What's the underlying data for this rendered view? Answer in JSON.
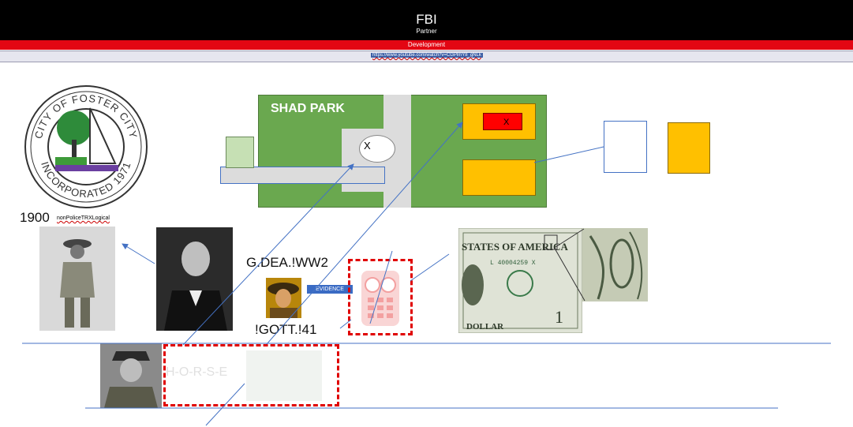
{
  "header": {
    "title": "FBI",
    "subtitle": "Partner",
    "bar_label": "Development",
    "url_text": "https://www.youtube.com/watch?v=CGPlmY8_gNLk"
  },
  "seal": {
    "top_text": "CITY OF FOSTER CITY",
    "bottom_text": "INCORPORATED 1971"
  },
  "park": {
    "title": "SHAD PARK",
    "marker_1": "X",
    "marker_2": "X"
  },
  "labels": {
    "year": "1900",
    "note": "nonPoliceTRXLogical",
    "gdea": "G.DEA.!WW2",
    "gott": "!GOTT.!41",
    "evidence": "EVIDENCE",
    "horse": "H-O-R-S-E"
  },
  "dollar": {
    "banner": "STATES OF AMERICA",
    "serial": "L 40004259 X",
    "denomination": "1",
    "word": "DOLLAR"
  },
  "colors": {
    "park_green": "#6aa84f",
    "accent_red": "#e30613",
    "box_orange": "#ffc000",
    "line_blue": "#4472c4"
  }
}
